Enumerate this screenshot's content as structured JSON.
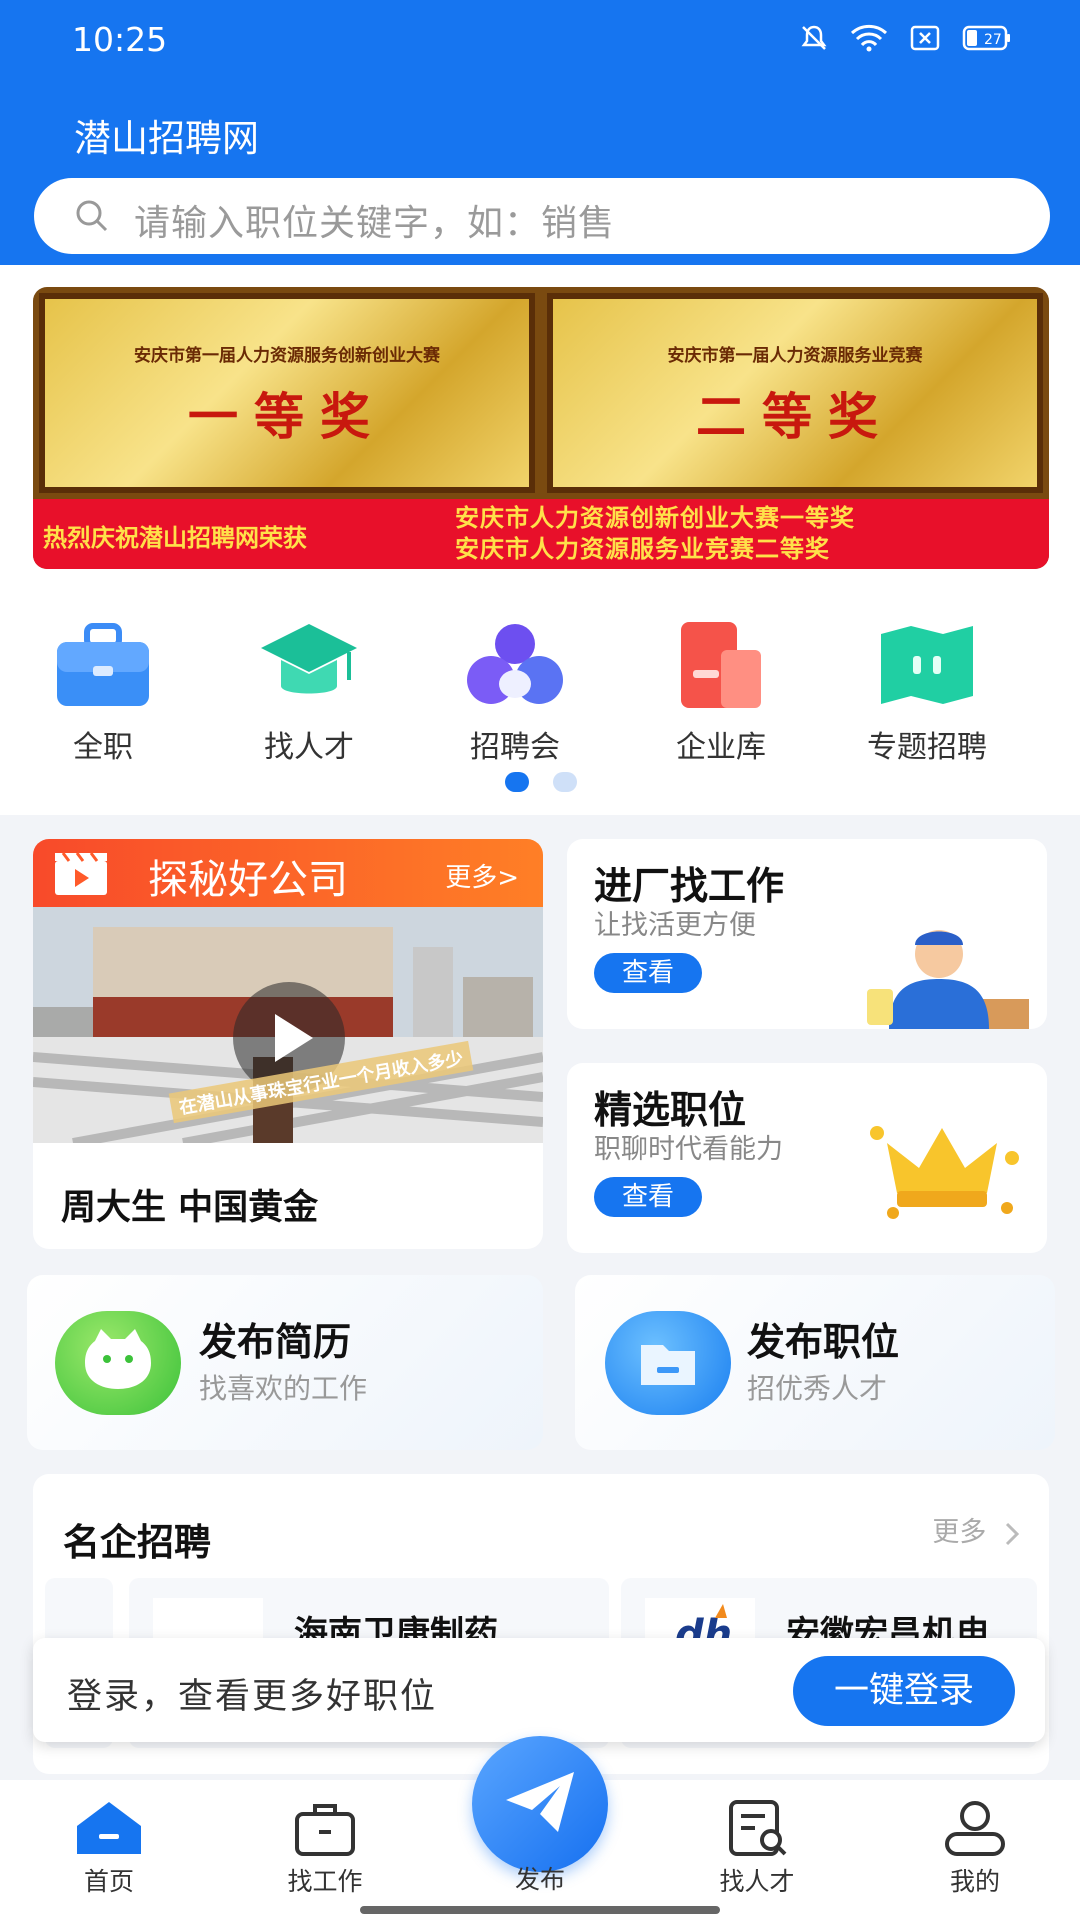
{
  "status_bar": {
    "time": "10:25",
    "battery": "27"
  },
  "header": {
    "title": "潜山招聘网"
  },
  "search": {
    "placeholder": "请输入职位关键字，如：销售"
  },
  "banner": {
    "plaque1_sub": "安庆市第一届人力资源服务创新创业大赛",
    "plaque1_main": "一等奖",
    "plaque2_sub": "安庆市第一届人力资源服务业竞赛",
    "plaque2_main": "二等奖",
    "strip_left": "热烈庆祝潜山招聘网荣获",
    "strip_right_line1": "安庆市人力资源创新创业大赛一等奖",
    "strip_right_line2": "安庆市人力资源服务业竞赛二等奖"
  },
  "categories": [
    {
      "label": "全职",
      "icon": "briefcase-icon",
      "color": "#2f86f6"
    },
    {
      "label": "找人才",
      "icon": "graduation-cap-icon",
      "color": "#1fc59c"
    },
    {
      "label": "招聘会",
      "icon": "group-icon",
      "color": "#6b4ff0"
    },
    {
      "label": "企业库",
      "icon": "building-icon",
      "color": "#f4544c"
    },
    {
      "label": "专题招聘",
      "icon": "map-icon",
      "color": "#1fd2a6"
    }
  ],
  "tansuo": {
    "title": "探秘好公司",
    "more": "更多>",
    "video_caption": "在潜山从事珠宝行业一个月收入多少",
    "name": "周大生 中国黄金"
  },
  "factory": {
    "title": "进厂找工作",
    "subtitle": "让找活更方便",
    "button": "查看"
  },
  "selected": {
    "title": "精选职位",
    "subtitle": "职聊时代看能力",
    "button": "查看"
  },
  "publish_resume": {
    "title": "发布简历",
    "subtitle": "找喜欢的工作"
  },
  "publish_job": {
    "title": "发布职位",
    "subtitle": "招优秀人才"
  },
  "famous": {
    "title": "名企招聘",
    "more": "更多",
    "companies": [
      "海南卫康制药…",
      "安徽宏昌机电"
    ]
  },
  "login": {
    "text": "登录，查看更多好职位",
    "button": "一键登录"
  },
  "tabs": [
    {
      "label": "首页"
    },
    {
      "label": "找工作"
    },
    {
      "label": "发布"
    },
    {
      "label": "找人才"
    },
    {
      "label": "我的"
    }
  ],
  "colors": {
    "primary": "#1675f0",
    "accent_orange": "#ff6a2a"
  }
}
